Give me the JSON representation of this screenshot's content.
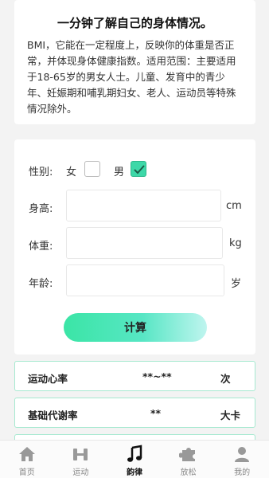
{
  "intro": {
    "title": "一分钟了解自己的身体情况。",
    "text": "BMI，它能在一定程度上，反映你的体重是否正常，并体现身体健康指数。适用范围：主要适用于18-65岁的男女人士。儿童、发育中的青少年、妊娠期和哺乳期妇女、老人、运动员等特殊情况除外。"
  },
  "form": {
    "gender_label": "性别:",
    "female": "女",
    "male": "男",
    "selected_gender": "男",
    "height_label": "身高:",
    "height_value": "",
    "height_unit": "cm",
    "weight_label": "体重:",
    "weight_value": "",
    "weight_unit": "kg",
    "age_label": "年龄:",
    "age_value": "",
    "age_unit": "岁",
    "calc_button": "计算"
  },
  "results": [
    {
      "label": "运动心率",
      "value": "**~**",
      "unit": "次"
    },
    {
      "label": "基础代谢率",
      "value": "**",
      "unit": "大卡"
    }
  ],
  "tabbar": [
    {
      "label": "首页",
      "icon": "home-icon"
    },
    {
      "label": "运动",
      "icon": "dumbbell-icon"
    },
    {
      "label": "韵律",
      "icon": "music-note-icon",
      "active": true
    },
    {
      "label": "放松",
      "icon": "puzzle-icon"
    },
    {
      "label": "我的",
      "icon": "user-icon"
    }
  ],
  "colors": {
    "accent": "#3dd8a8",
    "result_border": "#a6e9d0",
    "tab_inactive": "#888888",
    "tab_active": "#111111"
  }
}
